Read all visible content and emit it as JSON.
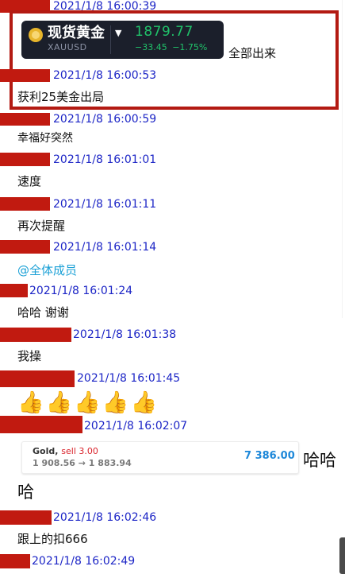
{
  "ticker": {
    "name": "现货黄金",
    "symbol": "XAUUSD",
    "price": "1879.77",
    "change": "−33.45  −1.75%",
    "up_color": "#20c26a"
  },
  "highlight_color": "#b31a12",
  "messages": [
    {
      "ts": "2021/1/8 16:00:39"
    },
    {
      "ts": "",
      "text": "全部出来"
    },
    {
      "ts": "2021/1/8 16:00:53",
      "text": "获利25美金出局"
    },
    {
      "ts": "2021/1/8 16:00:59",
      "text": "幸福好突然"
    },
    {
      "ts": "2021/1/8 16:01:01",
      "text": "速度"
    },
    {
      "ts": "2021/1/8 16:01:11",
      "text": "再次提醒"
    },
    {
      "ts": "2021/1/8 16:01:14",
      "text": "@全体成员"
    },
    {
      "ts": "2021/1/8 16:01:24",
      "text": "哈哈  谢谢"
    },
    {
      "ts": "2021/1/8 16:01:38",
      "text": "我操"
    },
    {
      "ts": "2021/1/8 16:01:45",
      "text": "👍👍👍👍👍"
    },
    {
      "ts": "2021/1/8 16:02:07",
      "text": "哈哈",
      "text2": "哈"
    },
    {
      "ts": "2021/1/8 16:02:46",
      "text": "跟上的扣666"
    },
    {
      "ts": "2021/1/8 16:02:49"
    }
  ],
  "trade_card": {
    "instrument": "Gold,",
    "action": "sell 3.00",
    "prices": "1 908.56 → 1 883.94",
    "profit": "7 386.00"
  },
  "colors": {
    "timestamp": "#1c25c6",
    "redaction": "#c11a10",
    "mention": "#1aa0d6",
    "sell": "#d9232b",
    "profit": "#1e88d9"
  }
}
